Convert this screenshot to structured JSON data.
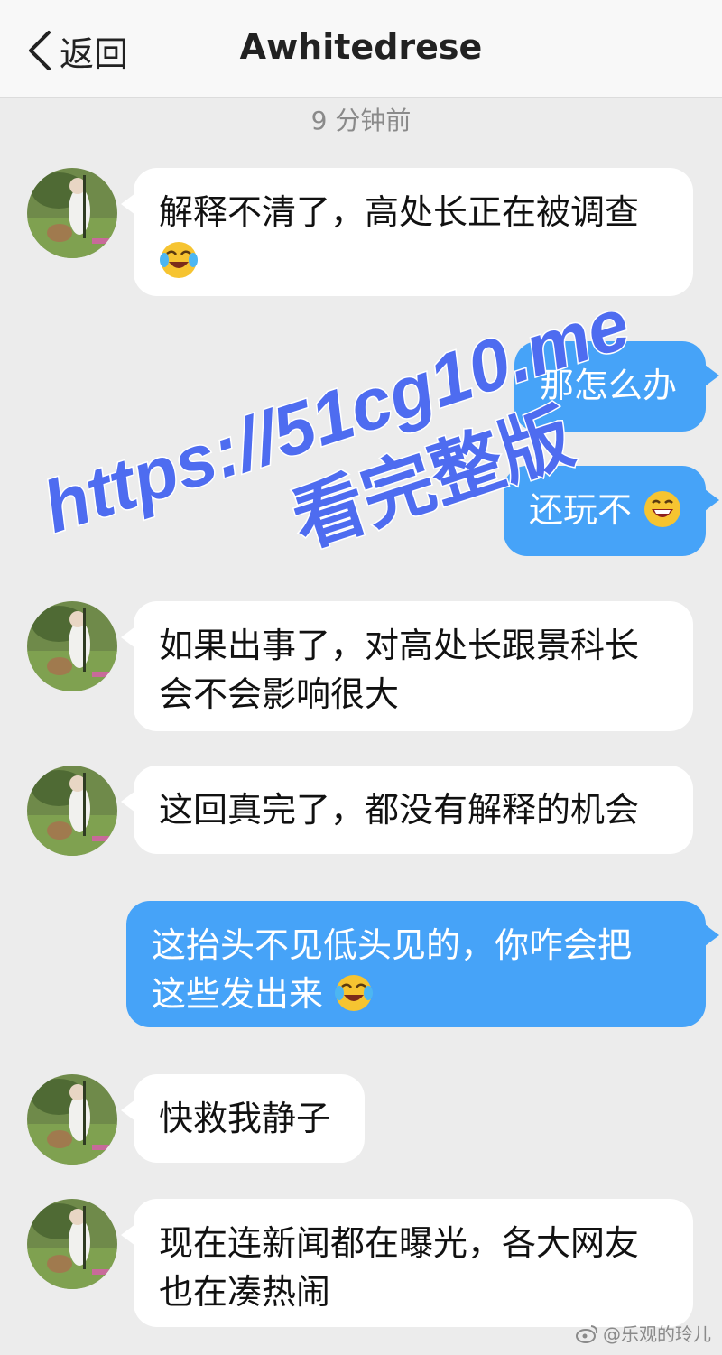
{
  "header": {
    "back_label": "返回",
    "title": "Awhitedrese"
  },
  "timestamp": "9 分钟前",
  "messages": [
    {
      "side": "in",
      "lines": [
        "解释不清了，高处长正在被调查"
      ],
      "emoji": "laugh-cry-emoji"
    },
    {
      "side": "out",
      "lines": [
        "那怎么办"
      ]
    },
    {
      "side": "out",
      "lines": [
        "还玩不"
      ],
      "emoji": "grin-emoji"
    },
    {
      "side": "in",
      "lines": [
        "如果出事了，对高处长跟景科长",
        "会不会影响很大"
      ]
    },
    {
      "side": "in",
      "lines": [
        "这回真完了，都没有解释的机会"
      ]
    },
    {
      "side": "out",
      "lines": [
        "这抬头不见低头见的，你咋会把",
        "这些发出来"
      ],
      "emoji": "laugh-cry-emoji"
    },
    {
      "side": "in",
      "lines": [
        "快救我静子"
      ]
    },
    {
      "side": "in",
      "lines": [
        "现在连新闻都在曝光，各大网友",
        "也在凑热闹"
      ]
    }
  ],
  "watermark": {
    "line1": "https://51cg10.me",
    "line2": "看完整版",
    "color": "#4e6cf0"
  },
  "credit": "@乐观的玲儿",
  "colors": {
    "background": "#ececec",
    "incoming_bubble": "#ffffff",
    "outgoing_bubble": "#46a3f8"
  }
}
